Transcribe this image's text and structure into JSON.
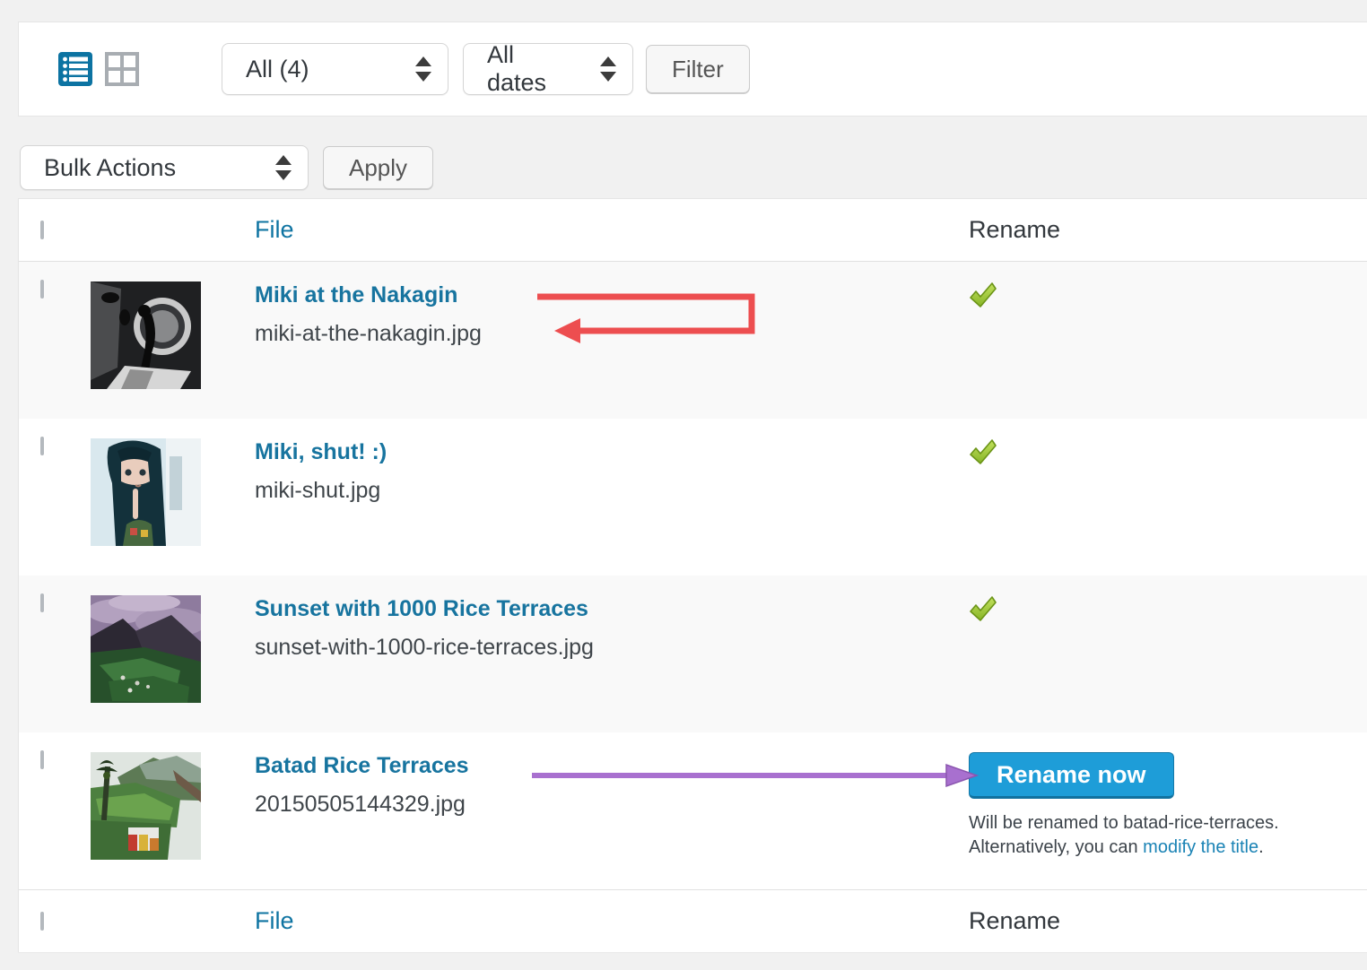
{
  "toolbar": {
    "attachment_filter_value": "All (4)",
    "date_filter_value": "All dates",
    "filter_button": "Filter"
  },
  "bulk_actions": {
    "select_value": "Bulk Actions",
    "apply_button": "Apply"
  },
  "table": {
    "header": {
      "file": "File",
      "rename": "Rename"
    },
    "footer": {
      "file": "File",
      "rename": "Rename"
    },
    "rows": [
      {
        "title": "Miki at the Nakagin",
        "filename": "miki-at-the-nakagin.jpg",
        "status": "renamed"
      },
      {
        "title": "Miki, shut! :)",
        "filename": "miki-shut.jpg",
        "status": "renamed"
      },
      {
        "title": "Sunset with 1000 Rice Terraces",
        "filename": "sunset-with-1000-rice-terraces.jpg",
        "status": "renamed"
      },
      {
        "title": "Batad Rice Terraces",
        "filename": "20150505144329.jpg",
        "status": "pending",
        "rename_button": "Rename now",
        "note_line1": "Will be renamed to batad-rice-terraces.",
        "note_line2_prefix": "Alternatively, you can ",
        "note_link": "modify the title",
        "note_line2_suffix": "."
      }
    ]
  },
  "icons": {
    "list_view": "list-view",
    "grid_view": "grid-view",
    "sort_stepper": "up-down-arrows",
    "renamed_check": "green-check"
  },
  "colors": {
    "page_background": "#f1f1f1",
    "accent_link_blue": "#0f74a2",
    "active_view_icon_blue": "#0c73a2",
    "rename_button_blue": "#1e9dd8",
    "check_green": "#8dc63f",
    "annotation_arrow_red": "#ed4e50",
    "annotation_arrow_purple": "#a870cf",
    "striped_row": "#f9f9f9"
  }
}
